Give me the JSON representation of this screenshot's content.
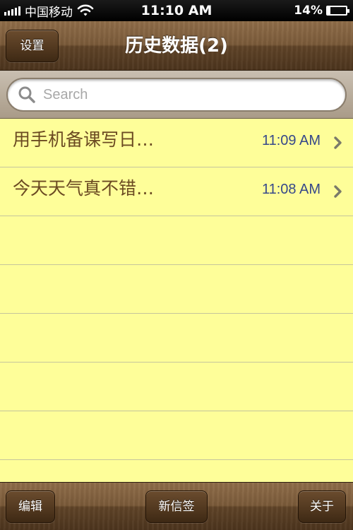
{
  "status_bar": {
    "carrier": "中国移动",
    "time": "11:10 AM",
    "battery_text": "14%",
    "battery_level": 0.14,
    "signal_bars": 5,
    "icons": [
      "signal-icon",
      "wifi-icon",
      "battery-icon"
    ]
  },
  "nav": {
    "title": "历史数据(2)",
    "settings_label": "设置"
  },
  "search": {
    "placeholder": "Search",
    "value": ""
  },
  "notes": [
    {
      "title": "用手机备课写日…",
      "time": "11:09 AM"
    },
    {
      "title": "今天天气真不错…",
      "time": "11:08 AM"
    }
  ],
  "toolbar": {
    "edit_label": "编辑",
    "new_label": "新信签",
    "about_label": "关于"
  },
  "colors": {
    "paper": "#fefe99",
    "note_text": "#6b4a22",
    "time_text": "#36488a",
    "wood": "#6e5133"
  }
}
